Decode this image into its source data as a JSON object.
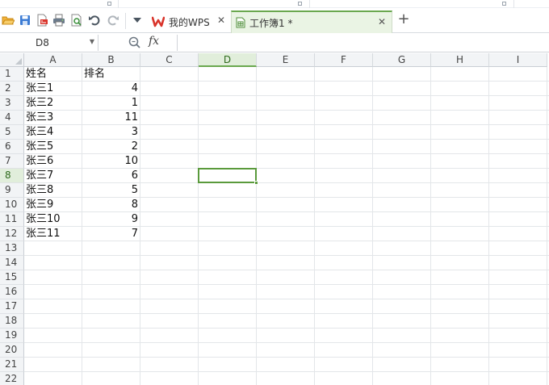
{
  "window": {
    "tabs": [
      {
        "label": "我的WPS",
        "icon": "wps-logo-icon",
        "active": false
      },
      {
        "label": "工作簿1 *",
        "icon": "sheet-doc-icon",
        "active": true
      }
    ]
  },
  "toolbar": {
    "icons": [
      "open-folder-icon",
      "save-icon",
      "export-pdf-icon",
      "print-icon",
      "print-preview-icon",
      "undo-icon",
      "redo-icon",
      "customize-dropdown-icon"
    ]
  },
  "formula_bar": {
    "name_box": "D8",
    "fx_label": "fx",
    "formula_value": ""
  },
  "sheet": {
    "columns": [
      "A",
      "B",
      "C",
      "D",
      "E",
      "F",
      "G",
      "H",
      "I"
    ],
    "rows": [
      "1",
      "2",
      "3",
      "4",
      "5",
      "6",
      "7",
      "8",
      "9",
      "10",
      "11",
      "12",
      "13",
      "14",
      "15",
      "16",
      "17",
      "18",
      "19",
      "20",
      "21",
      "22"
    ],
    "active_column": "D",
    "active_row": "8",
    "selected_cell": "D8",
    "data": [
      {
        "a": "姓名",
        "b": "排名",
        "b_is_number": false
      },
      {
        "a": "张三1",
        "b": "4",
        "b_is_number": true
      },
      {
        "a": "张三2",
        "b": "1",
        "b_is_number": true
      },
      {
        "a": "张三3",
        "b": "11",
        "b_is_number": true
      },
      {
        "a": "张三4",
        "b": "3",
        "b_is_number": true
      },
      {
        "a": "张三5",
        "b": "2",
        "b_is_number": true
      },
      {
        "a": "张三6",
        "b": "10",
        "b_is_number": true
      },
      {
        "a": "张三7",
        "b": "6",
        "b_is_number": true
      },
      {
        "a": "张三8",
        "b": "5",
        "b_is_number": true
      },
      {
        "a": "张三9",
        "b": "8",
        "b_is_number": true
      },
      {
        "a": "张三10",
        "b": "9",
        "b_is_number": true
      },
      {
        "a": "张三11",
        "b": "7",
        "b_is_number": true
      }
    ]
  },
  "colors": {
    "accent_green": "#6aa84f",
    "selection_border": "#5a9a3c",
    "wps_red": "#d9342b"
  }
}
